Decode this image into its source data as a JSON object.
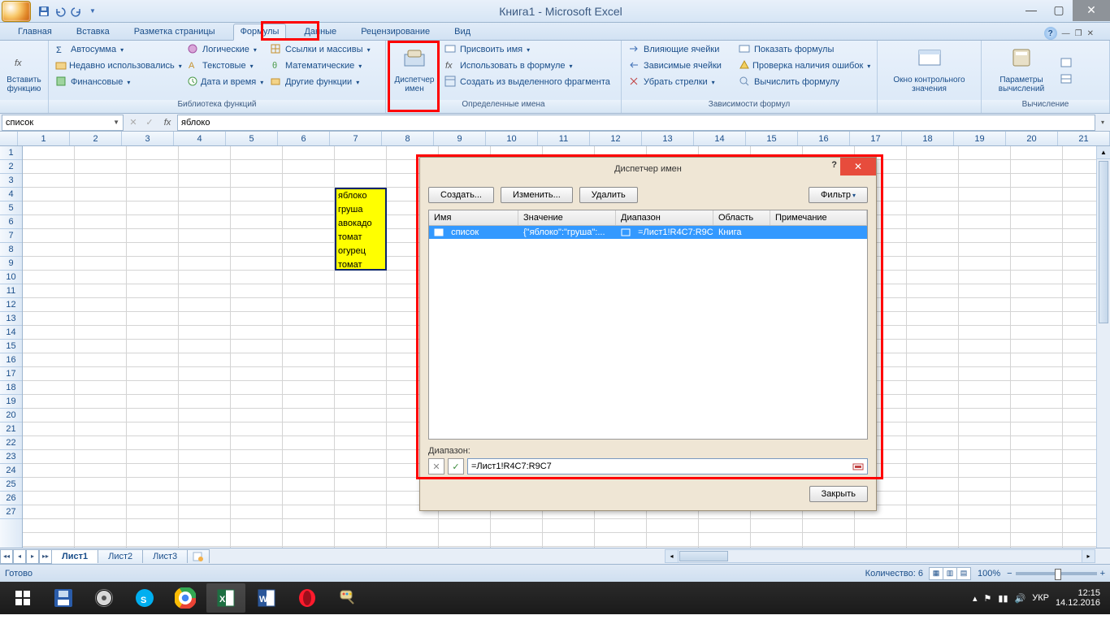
{
  "title": "Книга1 - Microsoft Excel",
  "tabs": [
    "Главная",
    "Вставка",
    "Разметка страницы",
    "Формулы",
    "Данные",
    "Рецензирование",
    "Вид"
  ],
  "active_tab_index": 3,
  "ribbon": {
    "insert_fn": "Вставить функцию",
    "lib_group": "Библиотека функций",
    "lib_items": [
      "Автосумма",
      "Недавно использовались",
      "Финансовые",
      "Логические",
      "Текстовые",
      "Дата и время",
      "Ссылки и массивы",
      "Математические",
      "Другие функции"
    ],
    "name_mgr": "Диспетчер имен",
    "names_group": "Определенные имена",
    "names_items": [
      "Присвоить имя",
      "Использовать в формуле",
      "Создать из выделенного фрагмента"
    ],
    "audit_group": "Зависимости формул",
    "audit_items": [
      "Влияющие ячейки",
      "Зависимые ячейки",
      "Убрать стрелки",
      "Показать формулы",
      "Проверка наличия ошибок",
      "Вычислить формулу"
    ],
    "watch": "Окно контрольного значения",
    "calc": "Параметры вычислений",
    "calc_group": "Вычисление"
  },
  "name_box": "список",
  "formula_value": "яблоко",
  "columns": [
    "1",
    "2",
    "3",
    "4",
    "5",
    "6",
    "7",
    "8",
    "9",
    "10",
    "11",
    "12",
    "13",
    "14",
    "15",
    "16",
    "17",
    "18",
    "19",
    "20",
    "21"
  ],
  "row_count": 27,
  "cell_values": [
    "яблоко",
    "груша",
    "авокадо",
    "томат",
    "огурец",
    "томат"
  ],
  "dialog": {
    "title": "Диспетчер имен",
    "btns": [
      "Создать...",
      "Изменить...",
      "Удалить"
    ],
    "filter": "Фильтр",
    "headers": [
      "Имя",
      "Значение",
      "Диапазон",
      "Область",
      "Примечание"
    ],
    "row": {
      "name": "список",
      "value": "{\"яблоко\":\"груша\":...",
      "range": "=Лист1!R4C7:R9C7",
      "scope": "Книга",
      "note": ""
    },
    "range_label": "Диапазон:",
    "range_value": "=Лист1!R4C7:R9C7",
    "close": "Закрыть"
  },
  "sheets": [
    "Лист1",
    "Лист2",
    "Лист3"
  ],
  "status": {
    "ready": "Готово",
    "count": "Количество: 6",
    "zoom": "100%"
  },
  "tray": {
    "lang": "УКР",
    "time": "12:15",
    "date": "14.12.2016"
  }
}
